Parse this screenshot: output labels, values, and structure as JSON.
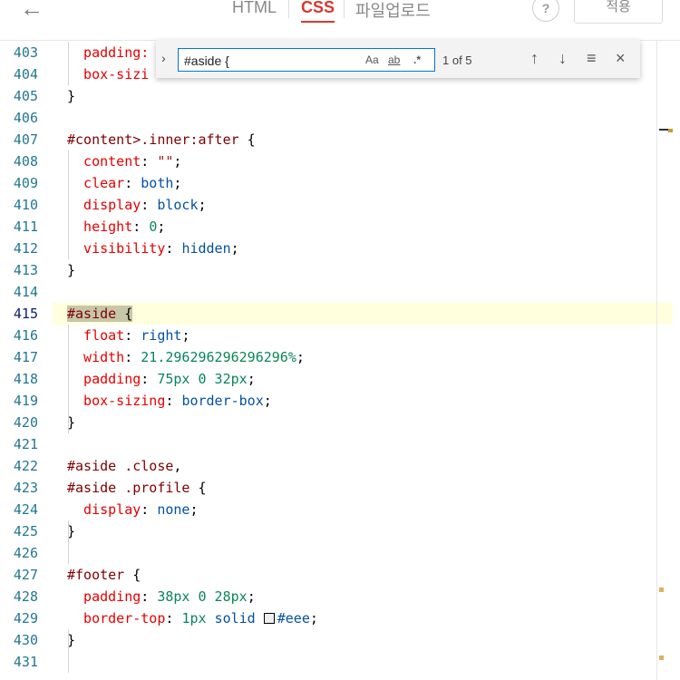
{
  "toolbar": {
    "back_icon": "arrow-left-icon",
    "tabs": [
      {
        "label": "HTML",
        "active": false
      },
      {
        "label": "CSS",
        "active": true
      },
      {
        "label": "파일업로드",
        "active": false
      }
    ],
    "help_label": "?",
    "apply_label": "적용"
  },
  "find": {
    "query": "#aside {",
    "match_case": "Aa",
    "whole_word": "ab",
    "regex": ".*",
    "count": "1 of 5"
  },
  "editor": {
    "current_line": "415",
    "lines": [
      {
        "n": "403",
        "t": [
          {
            "c": "prop",
            "v": "  padding:"
          }
        ]
      },
      {
        "n": "404",
        "t": [
          {
            "c": "prop",
            "v": "  box-sizi"
          }
        ]
      },
      {
        "n": "405",
        "t": [
          {
            "c": "pun",
            "v": "}"
          }
        ]
      },
      {
        "n": "406",
        "t": []
      },
      {
        "n": "407",
        "t": [
          {
            "c": "sel",
            "v": "#content>.inner:after"
          },
          {
            "c": "pun",
            "v": " {"
          }
        ]
      },
      {
        "n": "408",
        "t": [
          {
            "c": "prop",
            "v": "  content"
          },
          {
            "c": "pun",
            "v": ": "
          },
          {
            "c": "str",
            "v": "\"\""
          },
          {
            "c": "pun",
            "v": ";"
          }
        ]
      },
      {
        "n": "409",
        "t": [
          {
            "c": "prop",
            "v": "  clear"
          },
          {
            "c": "pun",
            "v": ": "
          },
          {
            "c": "val",
            "v": "both"
          },
          {
            "c": "pun",
            "v": ";"
          }
        ]
      },
      {
        "n": "410",
        "t": [
          {
            "c": "prop",
            "v": "  display"
          },
          {
            "c": "pun",
            "v": ": "
          },
          {
            "c": "val",
            "v": "block"
          },
          {
            "c": "pun",
            "v": ";"
          }
        ]
      },
      {
        "n": "411",
        "t": [
          {
            "c": "prop",
            "v": "  height"
          },
          {
            "c": "pun",
            "v": ": "
          },
          {
            "c": "num",
            "v": "0"
          },
          {
            "c": "pun",
            "v": ";"
          }
        ]
      },
      {
        "n": "412",
        "t": [
          {
            "c": "prop",
            "v": "  visibility"
          },
          {
            "c": "pun",
            "v": ": "
          },
          {
            "c": "val",
            "v": "hidden"
          },
          {
            "c": "pun",
            "v": ";"
          }
        ]
      },
      {
        "n": "413",
        "t": [
          {
            "c": "pun",
            "v": "}"
          }
        ]
      },
      {
        "n": "414",
        "t": []
      },
      {
        "n": "415",
        "t": [
          {
            "c": "sel",
            "v": "#aside",
            "h": true
          },
          {
            "c": "pun",
            "v": " {",
            "h": true
          }
        ]
      },
      {
        "n": "416",
        "t": [
          {
            "c": "prop",
            "v": "  float"
          },
          {
            "c": "pun",
            "v": ": "
          },
          {
            "c": "val",
            "v": "right"
          },
          {
            "c": "pun",
            "v": ";"
          }
        ]
      },
      {
        "n": "417",
        "t": [
          {
            "c": "prop",
            "v": "  width"
          },
          {
            "c": "pun",
            "v": ": "
          },
          {
            "c": "num",
            "v": "21.296296296296296%"
          },
          {
            "c": "pun",
            "v": ";"
          }
        ]
      },
      {
        "n": "418",
        "t": [
          {
            "c": "prop",
            "v": "  padding"
          },
          {
            "c": "pun",
            "v": ": "
          },
          {
            "c": "num",
            "v": "75px 0 32px"
          },
          {
            "c": "pun",
            "v": ";"
          }
        ]
      },
      {
        "n": "419",
        "t": [
          {
            "c": "prop",
            "v": "  box-sizing"
          },
          {
            "c": "pun",
            "v": ": "
          },
          {
            "c": "val",
            "v": "border-box"
          },
          {
            "c": "pun",
            "v": ";"
          }
        ]
      },
      {
        "n": "420",
        "t": [
          {
            "c": "pun",
            "v": "}"
          }
        ]
      },
      {
        "n": "421",
        "t": []
      },
      {
        "n": "422",
        "t": [
          {
            "c": "sel",
            "v": "#aside .close"
          },
          {
            "c": "pun",
            "v": ","
          }
        ]
      },
      {
        "n": "423",
        "t": [
          {
            "c": "sel",
            "v": "#aside .profile"
          },
          {
            "c": "pun",
            "v": " {"
          }
        ]
      },
      {
        "n": "424",
        "t": [
          {
            "c": "prop",
            "v": "  display"
          },
          {
            "c": "pun",
            "v": ": "
          },
          {
            "c": "val",
            "v": "none"
          },
          {
            "c": "pun",
            "v": ";"
          }
        ]
      },
      {
        "n": "425",
        "t": [
          {
            "c": "pun",
            "v": "}"
          }
        ]
      },
      {
        "n": "426",
        "t": []
      },
      {
        "n": "427",
        "t": [
          {
            "c": "sel",
            "v": "#footer"
          },
          {
            "c": "pun",
            "v": " {"
          }
        ]
      },
      {
        "n": "428",
        "t": [
          {
            "c": "prop",
            "v": "  padding"
          },
          {
            "c": "pun",
            "v": ": "
          },
          {
            "c": "num",
            "v": "38px 0 28px"
          },
          {
            "c": "pun",
            "v": ";"
          }
        ]
      },
      {
        "n": "429",
        "t": [
          {
            "c": "prop",
            "v": "  border-top"
          },
          {
            "c": "pun",
            "v": ": "
          },
          {
            "c": "num",
            "v": "1px"
          },
          {
            "c": "pun",
            "v": " "
          },
          {
            "c": "val",
            "v": "solid"
          },
          {
            "c": "pun",
            "v": " "
          },
          {
            "c": "swatch",
            "v": ""
          },
          {
            "c": "val",
            "v": "#eee"
          },
          {
            "c": "pun",
            "v": ";"
          }
        ]
      },
      {
        "n": "430",
        "t": [
          {
            "c": "pun",
            "v": "}"
          }
        ]
      },
      {
        "n": "431",
        "t": []
      }
    ]
  },
  "colors": {
    "accent": "#d9372e",
    "line_number": "#237893",
    "selector": "#800000",
    "property": "#e50000",
    "value": "#0451a5",
    "number": "#098658",
    "current_line_bg": "#ffffdd",
    "find_border": "#0078d4"
  }
}
